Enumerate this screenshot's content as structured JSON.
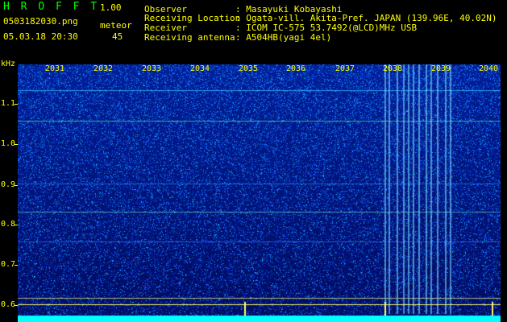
{
  "header": {
    "brand": "H R O F F T",
    "version": "1.00",
    "filename": "0503182030.png",
    "datetime": "05.03.18 20:30",
    "meteor_label": "meteor",
    "meteor_count": "45",
    "observer_label": "Observer",
    "observer_value": ": Masayuki Kobayashi",
    "location_label": "Receiving Location",
    "location_value": ": Ogata-vill. Akita-Pref. JAPAN (139.96E, 40.02N)",
    "receiver_label": "Receiver",
    "receiver_value": ": ICOM IC-575 53.7492(@LCD)MHz USB",
    "antenna_label": "Receiving antenna",
    "antenna_value": ": A504HB(yagi 4el)"
  },
  "axis": {
    "unit": "kHz",
    "y_ticks": [
      "1.1",
      "1.0",
      "0.9",
      "0.8",
      "0.7",
      "0.6"
    ],
    "x_ticks": [
      "2031",
      "2032",
      "2033",
      "2034",
      "2035",
      "2036",
      "2037",
      "2038",
      "2039",
      "2040"
    ]
  },
  "colors": {
    "background": "#000000",
    "label": "#ffff00",
    "brand": "#00ff00",
    "spectrum_base": "#001a8c",
    "spectrum_dark": "#000b44",
    "noise": "#1a44ff",
    "noise_hot": "#00ccff",
    "meteor": "#ffff66",
    "baseline": "#00ffff"
  }
}
